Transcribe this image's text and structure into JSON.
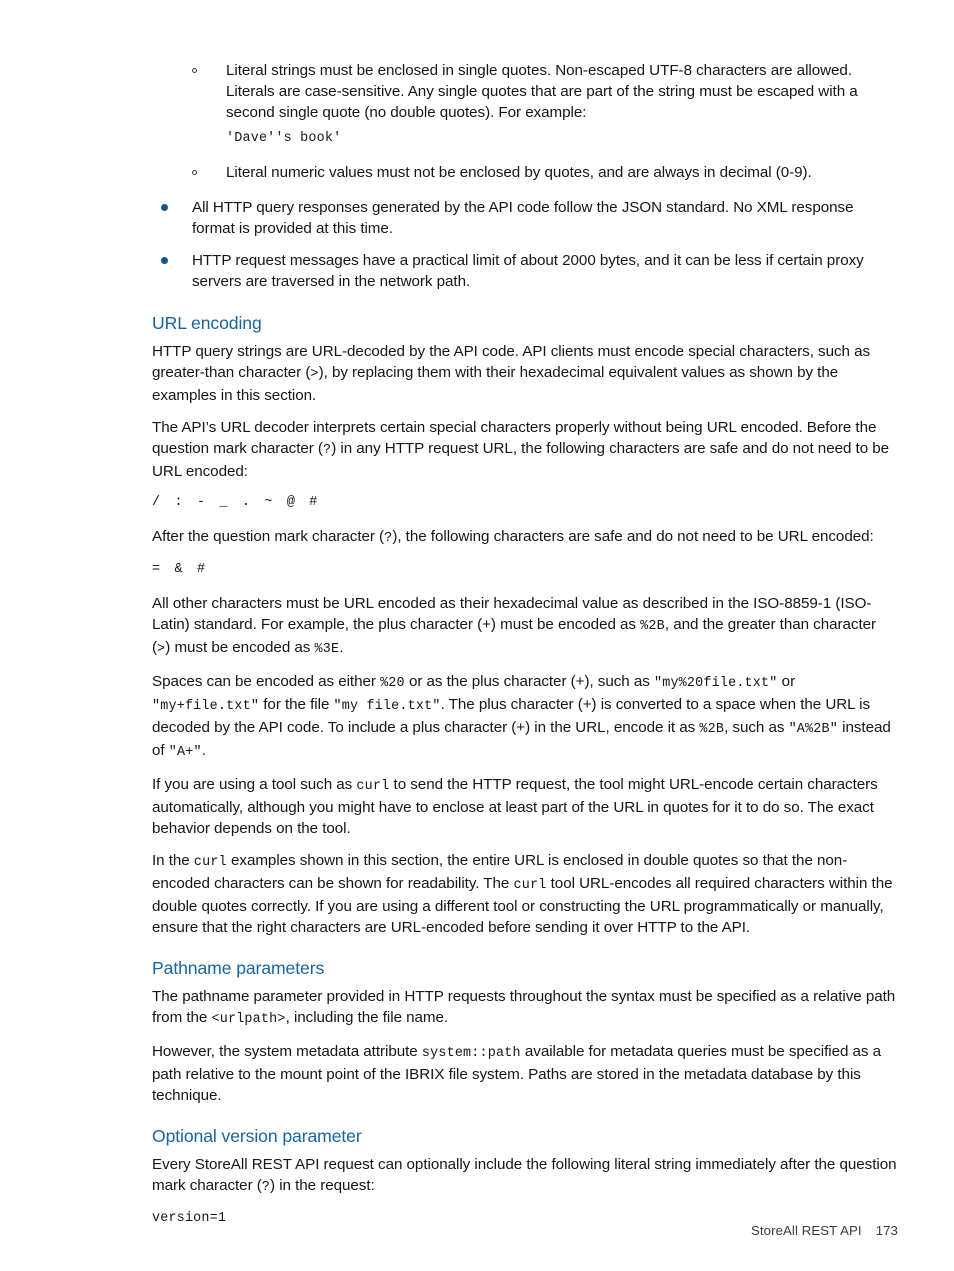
{
  "document": {
    "footer": {
      "chapter": "StoreAll REST API",
      "page_number": "173"
    }
  },
  "bullets_sub": [
    {
      "text": "Literal strings must be enclosed in single quotes. Non-escaped UTF-8 characters are allowed. Literals are case-sensitive. Any single quotes that are part of the string must be escaped with a second single quote (no double quotes). For example:"
    },
    {
      "text": "Literal numeric values must not be enclosed by quotes, and are always in decimal (0-9)."
    }
  ],
  "code_samples": {
    "dave_book": "'Dave''s book'",
    "safe_before_question": "/ : - _ . ~ @ #",
    "safe_after_question": "= & #",
    "version_literal": "version=1"
  },
  "bullets_main": [
    {
      "text": "All HTTP query responses generated by the API code follow the JSON standard. No XML response format is provided at this time."
    },
    {
      "text": "HTTP request messages have a practical limit of about 2000 bytes, and it can be less if certain proxy servers are traversed in the network path."
    }
  ],
  "sections": [
    {
      "id": "url-encoding",
      "heading": "URL encoding",
      "paragraphs": {
        "p1_a": "HTTP query strings are URL-decoded by the API code. API clients must encode special characters, such as greater-than character (",
        "p1_code": ">",
        "p1_b": "), by replacing them with their hexadecimal equivalent values as shown by the examples in this section.",
        "p2_a": "The API’s URL decoder interprets certain special characters properly without being URL encoded. Before the question mark character (",
        "p2_code": "?",
        "p2_b": ") in any HTTP request URL, the following characters are safe and do not need to be URL encoded:",
        "p3_a": "After the question mark character (",
        "p3_code": "?",
        "p3_b": "), the following characters are safe and do not need to be URL encoded:",
        "p4_a": "All other characters must be URL encoded as their hexadecimal value as described in the ISO-8859-1 (ISO-Latin) standard. For example, the plus character (+) must be encoded as ",
        "p4_code1": "%2B",
        "p4_b": ", and the greater than character (",
        "p4_code2": ">",
        "p4_c": ") must be encoded as ",
        "p4_code3": "%3E",
        "p4_d": ".",
        "p5_a": "Spaces can be encoded as either ",
        "p5_code1": "%20",
        "p5_b": " or as the plus character (+), such as ",
        "p5_code2": "\"my%20file.txt\"",
        "p5_c": " or ",
        "p5_code3": "\"my+file.txt\"",
        "p5_d": " for the file ",
        "p5_code4": "\"my file.txt\"",
        "p5_e": ". The plus character (+) is converted to a space when the URL is decoded by the API code. To include a plus character (+) in the URL, encode it as ",
        "p5_code5": "%2B",
        "p5_f": ", such as ",
        "p5_code6": "\"A%2B\"",
        "p5_g": " instead of ",
        "p5_code7": "\"A+\"",
        "p5_h": ".",
        "p6_a": "If you are using a tool such as ",
        "p6_code": "curl",
        "p6_b": " to send the HTTP request, the tool might URL-encode certain characters automatically, although you might have to enclose at least part of the URL in quotes for it to do so. The exact behavior depends on the tool.",
        "p7_a": "In the ",
        "p7_code1": "curl",
        "p7_b": " examples shown in this section, the entire URL is enclosed in double quotes so that the non-encoded characters can be shown for readability. The ",
        "p7_code2": "curl",
        "p7_c": " tool URL-encodes all required characters within the double quotes correctly. If you are using a different tool or constructing the URL programmatically or manually, ensure that the right characters are URL-encoded before sending it over HTTP to the API."
      }
    },
    {
      "id": "pathname-parameters",
      "heading": "Pathname parameters",
      "paragraphs": {
        "p1_a": "The pathname parameter provided in HTTP requests throughout the syntax must be specified as a relative path from the ",
        "p1_code": "<urlpath>",
        "p1_b": ", including the file name.",
        "p2_a": "However, the system metadata attribute ",
        "p2_code": "system::path",
        "p2_b": " available for metadata queries must be specified as a path relative to the mount point of the IBRIX file system. Paths are stored in the metadata database by this technique."
      }
    },
    {
      "id": "optional-version-parameter",
      "heading": "Optional version parameter",
      "paragraphs": {
        "p1_a": "Every StoreAll REST API request can optionally include the following literal string immediately after the question mark character (",
        "p1_code": "?",
        "p1_b": ") in the request:"
      }
    }
  ],
  "colors": {
    "heading_blue": "#17659E",
    "bullet_blue": "#14568F",
    "body_text": "#161616",
    "page_background": "#ffffff"
  }
}
